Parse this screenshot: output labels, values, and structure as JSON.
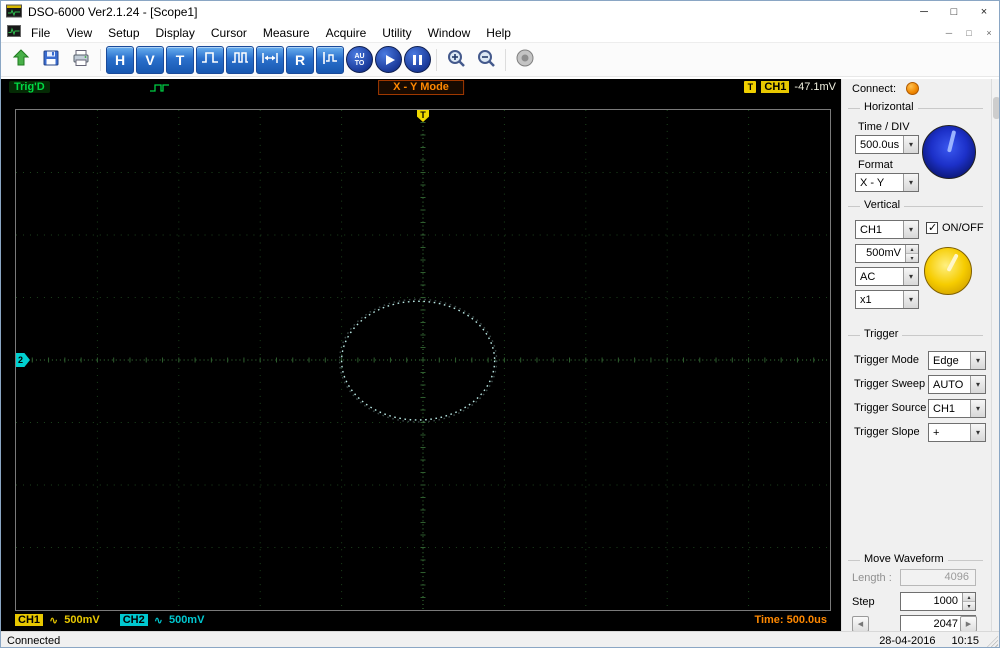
{
  "window": {
    "title": "DSO-6000 Ver2.1.24 - [Scope1]",
    "controls": {
      "min": "─",
      "max": "□",
      "close": "×"
    }
  },
  "mdi": {
    "min": "─",
    "restore": "□",
    "close": "×"
  },
  "menu": {
    "items": [
      "File",
      "View",
      "Setup",
      "Display",
      "Cursor",
      "Measure",
      "Acquire",
      "Utility",
      "Window",
      "Help"
    ]
  },
  "toolbar": {
    "h": "H",
    "v": "V",
    "t": "T",
    "r": "R",
    "auto": "AUTO",
    "icons": [
      "open",
      "save",
      "print",
      "horizontal-settings",
      "vertical-settings",
      "trigger-settings",
      "pulse-width",
      "pulse-train",
      "auto-scale",
      "refresh",
      "measure-waveform",
      "auto-setup",
      "run",
      "pause",
      "zoom-in",
      "zoom-out",
      "snapshot"
    ]
  },
  "strip": {
    "trig_status": "Trig'D",
    "mode": "X - Y Mode",
    "trigger_icon": "T",
    "trigger_source": "CH1",
    "trigger_level": "-47.1mV"
  },
  "scope": {
    "marker_top": "T",
    "marker_left": "2",
    "grid": {
      "cols": 10,
      "rows": 8
    },
    "trace": {
      "type": "xy-ellipse",
      "cx_div": 4.94,
      "cy_div": 4.01,
      "rx_div": 0.94,
      "ry_div": 0.95,
      "color": "#b9e8e4"
    },
    "ch1": {
      "label": "CH1",
      "coupling": "∿",
      "scale": "500mV"
    },
    "ch2": {
      "label": "CH2",
      "coupling": "∿",
      "scale": "500mV"
    },
    "time": "Time: 500.0us"
  },
  "panel": {
    "connect_label": "Connect:",
    "horizontal": {
      "title": "Horizontal",
      "time_div_label": "Time / DIV",
      "time_div_value": "500.0us",
      "format_label": "Format",
      "format_value": "X - Y"
    },
    "vertical": {
      "title": "Vertical",
      "channel_value": "CH1",
      "onoff_label": "ON/OFF",
      "scale_value": "500mV",
      "coupling_value": "AC",
      "probe_value": "x1"
    },
    "trigger": {
      "title": "Trigger",
      "rows": [
        {
          "label": "Trigger Mode",
          "value": "Edge"
        },
        {
          "label": "Trigger Sweep",
          "value": "AUTO"
        },
        {
          "label": "Trigger Source",
          "value": "CH1"
        },
        {
          "label": "Trigger Slope",
          "value": "+"
        }
      ]
    },
    "move": {
      "title": "Move Waveform",
      "length_label": "Length :",
      "length_value": "4096",
      "step_label": "Step",
      "step_value": "1000",
      "position_value": "2047"
    }
  },
  "statusbar": {
    "status": "Connected",
    "date": "28-04-2016",
    "time": "10:15"
  }
}
